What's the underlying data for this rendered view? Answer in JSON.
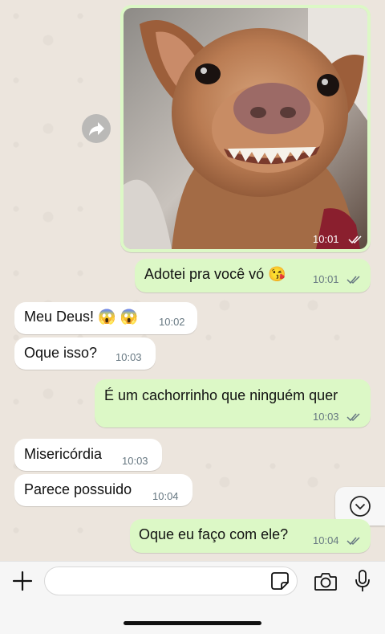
{
  "messages": [
    {
      "direction": "out",
      "type": "image",
      "time": "10:01",
      "status": "read"
    },
    {
      "direction": "out",
      "text": "Adotei pra você vó 😘",
      "time": "10:01",
      "status": "read"
    },
    {
      "direction": "in",
      "text": "Meu Deus! 😱 😱",
      "time": "10:02"
    },
    {
      "direction": "in",
      "text": "Oque isso?",
      "time": "10:03"
    },
    {
      "direction": "out",
      "text": "É um cachorrinho que ninguém quer",
      "time": "10:03",
      "status": "read"
    },
    {
      "direction": "in",
      "text": "Misericórdia",
      "time": "10:03"
    },
    {
      "direction": "in",
      "text": "Parece possuido",
      "time": "10:04"
    },
    {
      "direction": "out",
      "text": "Oque eu faço com ele?",
      "time": "10:04",
      "status": "read"
    }
  ],
  "icons": {
    "forward": "forward-icon",
    "scroll_down": "chevron-down-icon",
    "attach": "plus-icon",
    "sticker": "sticker-icon",
    "camera": "camera-icon",
    "mic": "microphone-icon"
  },
  "input": {
    "placeholder": ""
  },
  "colors": {
    "outgoing": "#dcf8c6",
    "incoming": "#ffffff",
    "read_ticks": "#667781"
  }
}
